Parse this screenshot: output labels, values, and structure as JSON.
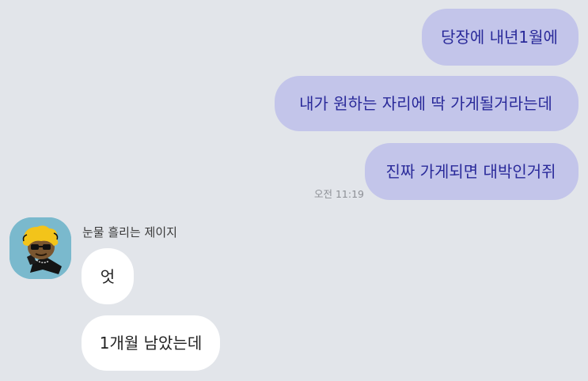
{
  "chat": {
    "outgoing": [
      {
        "text": "당장에 내년1월에"
      },
      {
        "text": "내가 원하는 자리에 딱 가게될거라는데"
      },
      {
        "text": "진짜 가게되면 대박인거쥐"
      }
    ],
    "outgoing_time": "오전 11:19",
    "sender": {
      "name": "눈물 흘리는 제이지",
      "avatar_icon": "character-avatar-icon"
    },
    "incoming": [
      {
        "text": "엇"
      },
      {
        "text": "1개월 남았는데"
      }
    ]
  },
  "colors": {
    "background": "#e2e5ea",
    "outgoing_bubble": "#c3c5ea",
    "outgoing_text": "#2a2a9a",
    "incoming_bubble": "#ffffff",
    "avatar_bg": "#7ab9cd"
  }
}
